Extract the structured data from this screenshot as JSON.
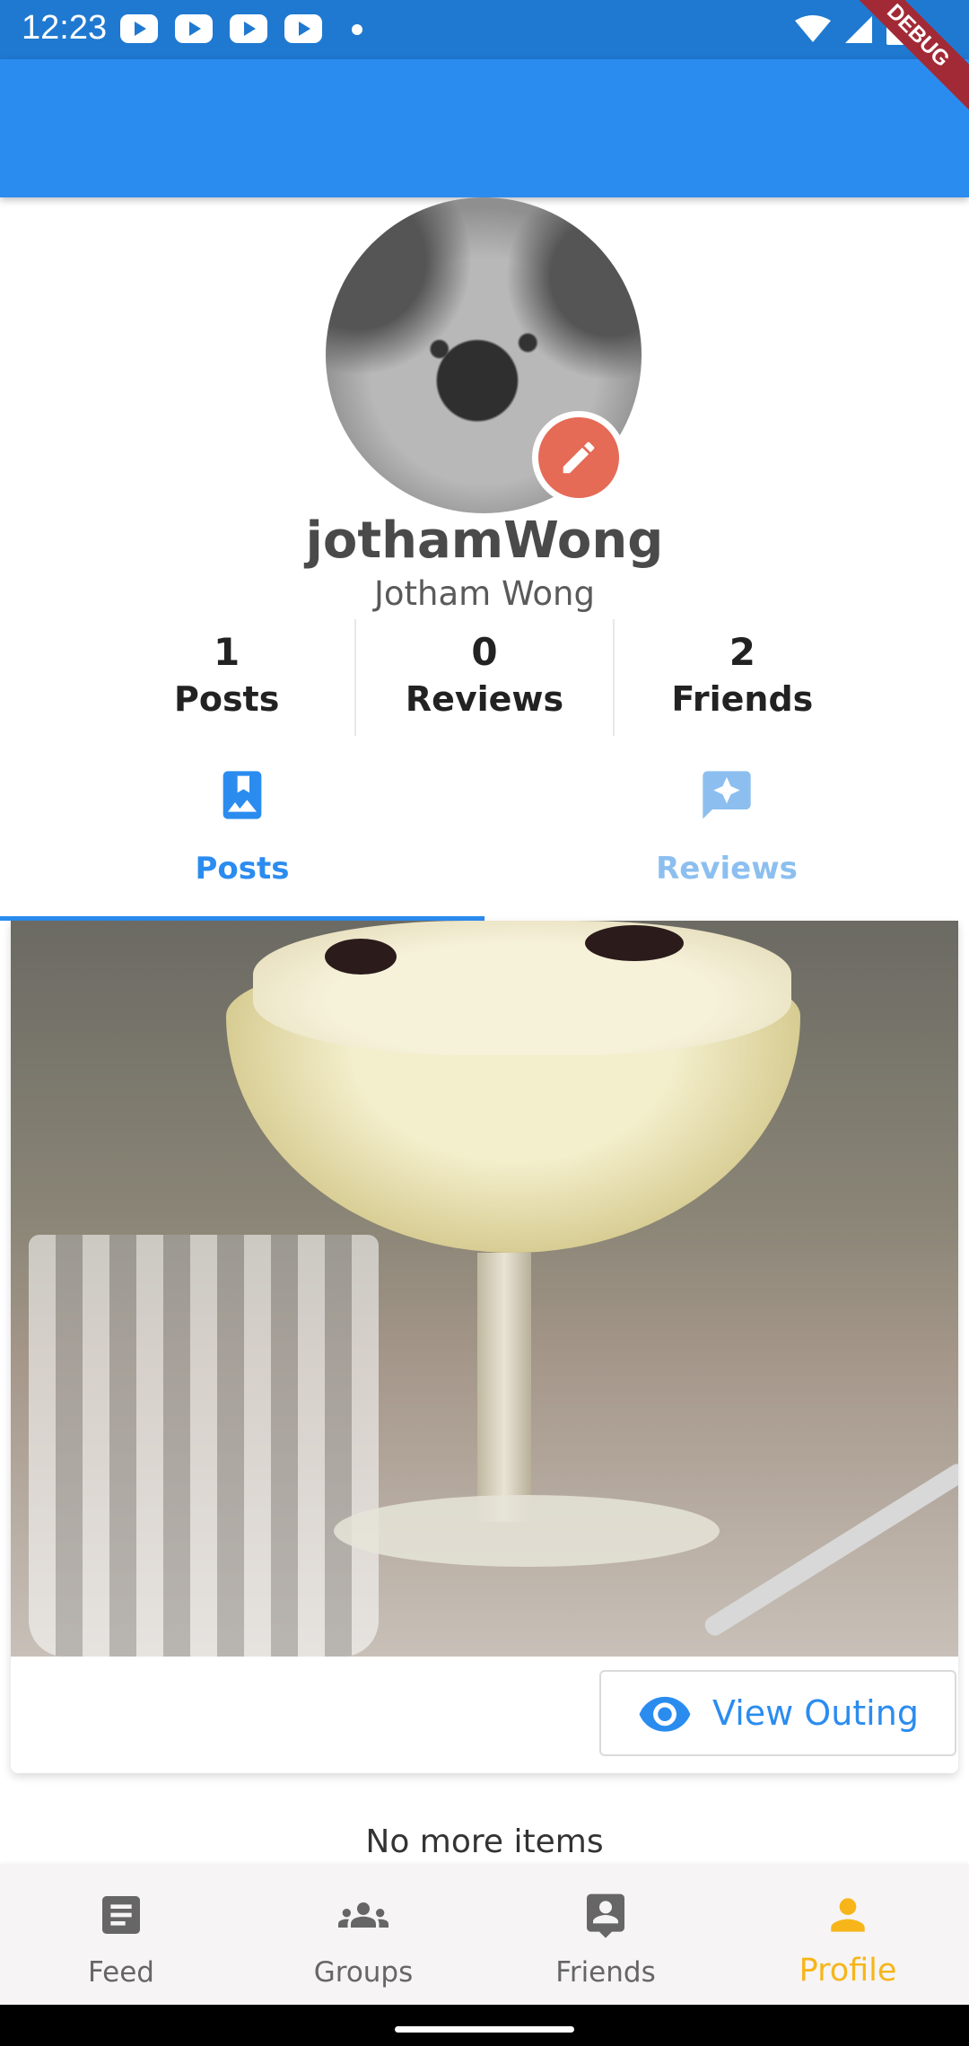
{
  "status_bar": {
    "time": "12:23"
  },
  "debug_banner": "DEBUG",
  "profile": {
    "username": "jothamWong",
    "full_name": "Jotham Wong"
  },
  "stats": [
    {
      "value": "1",
      "label": "Posts"
    },
    {
      "value": "0",
      "label": "Reviews"
    },
    {
      "value": "2",
      "label": "Friends"
    }
  ],
  "tabs": [
    {
      "label": "Posts",
      "active": true
    },
    {
      "label": "Reviews",
      "active": false
    }
  ],
  "post": {
    "view_button_label": "View Outing"
  },
  "list_end_text": "No more items",
  "bottom_nav": [
    {
      "label": "Feed",
      "icon": "article-icon",
      "active": false
    },
    {
      "label": "Groups",
      "icon": "groups-icon",
      "active": false
    },
    {
      "label": "Friends",
      "icon": "contact-icon",
      "active": false
    },
    {
      "label": "Profile",
      "icon": "person-icon",
      "active": true
    }
  ],
  "colors": {
    "primary": "#2b8cf0",
    "status_bar": "#1f79d1",
    "active_nav": "#f7b51a",
    "edit_button": "#e56b57",
    "debug_banner": "#a22a36"
  }
}
